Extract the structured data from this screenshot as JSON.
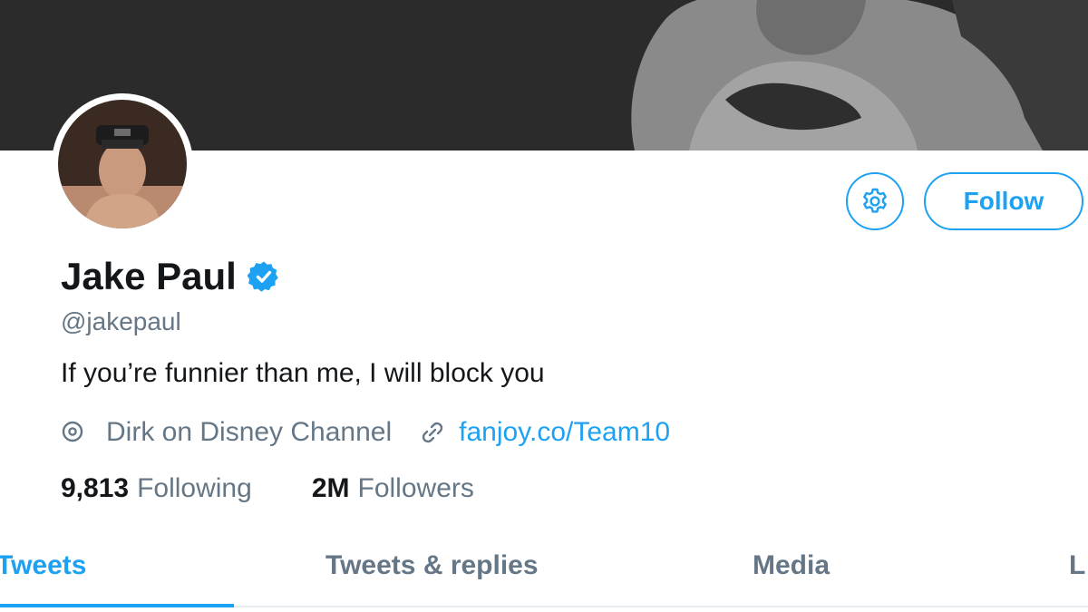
{
  "profile": {
    "display_name": "Jake Paul",
    "verified": true,
    "handle": "@jakepaul",
    "bio": "If you’re funnier than me, I will block you",
    "location": "Dirk on Disney Channel",
    "url": "fanjoy.co/Team10"
  },
  "actions": {
    "follow_label": "Follow",
    "settings_icon": "gear-icon"
  },
  "stats": {
    "following_count": "9,813",
    "following_label": "Following",
    "followers_count": "2M",
    "followers_label": "Followers"
  },
  "tabs": [
    {
      "label": "Tweets",
      "active": true
    },
    {
      "label": "Tweets & replies",
      "active": false
    },
    {
      "label": "Media",
      "active": false
    },
    {
      "label": "L",
      "active": false
    }
  ],
  "colors": {
    "accent": "#1da1f2",
    "secondary_text": "#657786",
    "primary_text": "#14171a",
    "banner": "#2c2c2c"
  }
}
